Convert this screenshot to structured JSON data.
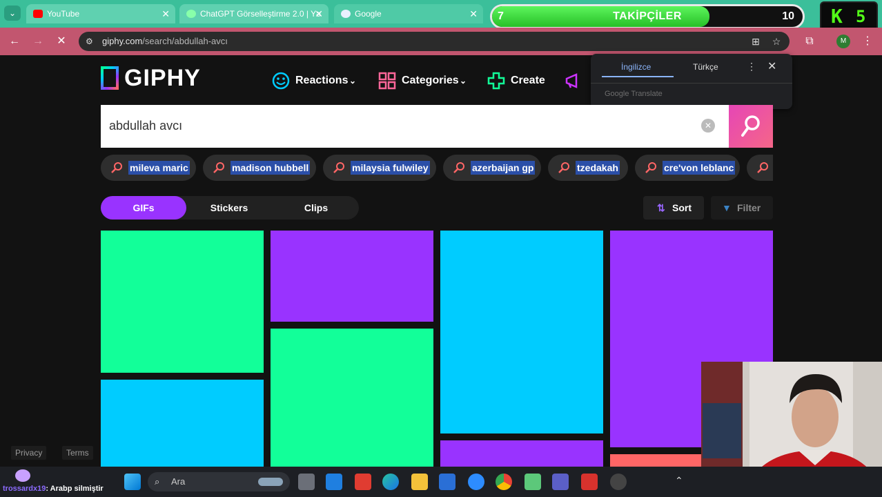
{
  "browser": {
    "tabs": [
      {
        "title": "YouTube",
        "favicon": "youtube-icon"
      },
      {
        "title": "ChatGPT Görselleştirme 2.0 | Yə",
        "favicon": "loading-icon"
      },
      {
        "title": "Google",
        "favicon": "google-icon"
      }
    ],
    "url": {
      "domain": "giphy.com",
      "path": "/search/abdullah-avcı"
    },
    "profile_initial": "M"
  },
  "overlay": {
    "followers_current": "7",
    "followers_title": "TAKİPÇİLER",
    "followers_goal": "10",
    "followers_progress": 0.7,
    "kick_letter": "K",
    "kick_count": "5"
  },
  "translate_popup": {
    "lang_source": "İngilizce",
    "lang_target": "Türkçe",
    "brand": "Google Translate"
  },
  "giphy": {
    "logo": "GIPHY",
    "nav": {
      "reactions": "Reactions",
      "categories": "Categories",
      "create": "Create"
    },
    "search_value": "abdullah avcı",
    "suggestions": [
      "mileva maric",
      "madison hubbell",
      "milaysia fulwiley",
      "azerbaijan gp",
      "tzedakah",
      "cre'von leblanc"
    ],
    "type_tabs": [
      "GIFs",
      "Stickers",
      "Clips"
    ],
    "sort_label": "Sort",
    "filter_label": "Filter",
    "footer": {
      "privacy": "Privacy",
      "terms": "Terms"
    }
  },
  "taskbar": {
    "chat_user": "trossardx19",
    "chat_message": ": Arabp silmiştir",
    "search_placeholder": "Ara"
  },
  "colors": {
    "green": "#12ff99",
    "purple": "#9933ff",
    "cyan": "#00ccff",
    "red": "#ff6666",
    "tabstrip": "#3bbf9a",
    "addressbar": "#c2566f"
  }
}
